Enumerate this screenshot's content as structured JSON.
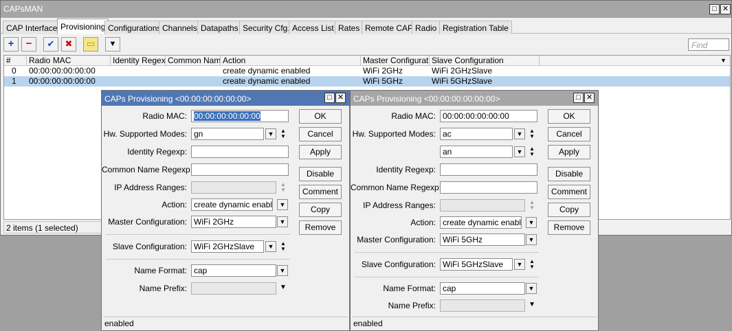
{
  "app": {
    "title": "CAPsMAN",
    "minimize": "□",
    "close": "✕"
  },
  "tabs": [
    "CAP Interface",
    "Provisioning",
    "Configurations",
    "Channels",
    "Datapaths",
    "Security Cfg.",
    "Access List",
    "Rates",
    "Remote CAP",
    "Radio",
    "Registration Table"
  ],
  "active_tab": "Provisioning",
  "toolbar": {
    "add": "+",
    "remove": "−",
    "enable": "✔",
    "disable": "✖",
    "comment": "▭",
    "filter": "▼",
    "find_placeholder": "Find"
  },
  "table": {
    "columns": [
      "#",
      "Radio MAC",
      "Identity Regexp",
      "Common Nam...",
      "Action",
      "Master Configurati...",
      "Slave Configuration"
    ],
    "rows": [
      {
        "num": "0",
        "mac": "00:00:00:00:00:00",
        "identity": "",
        "common": "",
        "action": "create dynamic enabled",
        "master": "WiFi 2GHz",
        "slave": "WiFi 2GHzSlave"
      },
      {
        "num": "1",
        "mac": "00:00:00:00:00:00",
        "identity": "",
        "common": "",
        "action": "create dynamic enabled",
        "master": "WiFi 5GHz",
        "slave": "WiFi 5GHzSlave"
      }
    ],
    "status": "2 items (1 selected)"
  },
  "dialog_left": {
    "title": "CAPs Provisioning <00:00:00:00:00:00>",
    "labels": {
      "radio_mac": "Radio MAC:",
      "hw_modes": "Hw. Supported Modes:",
      "identity": "Identity Regexp:",
      "common": "Common Name Regexp:",
      "ip_ranges": "IP Address Ranges:",
      "action": "Action:",
      "master": "Master Configuration:",
      "slave": "Slave Configuration:",
      "name_format": "Name Format:",
      "name_prefix": "Name Prefix:"
    },
    "values": {
      "radio_mac": "00:00:00:00:00:00",
      "hw_mode_1": "gn",
      "identity": "",
      "common": "",
      "ip_ranges": "",
      "action": "create dynamic enabled",
      "master": "WiFi 2GHz",
      "slave": "WiFi 2GHzSlave",
      "name_format": "cap",
      "name_prefix": ""
    },
    "buttons": [
      "OK",
      "Cancel",
      "Apply",
      "Disable",
      "Comment",
      "Copy",
      "Remove"
    ],
    "status": "enabled"
  },
  "dialog_right": {
    "title": "CAPs Provisioning <00:00:00:00:00:00>",
    "labels": {
      "radio_mac": "Radio MAC:",
      "hw_modes": "Hw. Supported Modes:",
      "identity": "Identity Regexp:",
      "common": "Common Name Regexp:",
      "ip_ranges": "IP Address Ranges:",
      "action": "Action:",
      "master": "Master Configuration:",
      "slave": "Slave Configuration:",
      "name_format": "Name Format:",
      "name_prefix": "Name Prefix:"
    },
    "values": {
      "radio_mac": "00:00:00:00:00:00",
      "hw_mode_1": "ac",
      "hw_mode_2": "an",
      "identity": "",
      "common": "",
      "ip_ranges": "",
      "action": "create dynamic enabled",
      "master": "WiFi 5GHz",
      "slave": "WiFi 5GHzSlave",
      "name_format": "cap",
      "name_prefix": ""
    },
    "buttons": [
      "OK",
      "Cancel",
      "Apply",
      "Disable",
      "Comment",
      "Copy",
      "Remove"
    ],
    "status": "enabled"
  },
  "colors": {
    "active_title": "#5177b3",
    "inactive_title": "#a6a6a6",
    "selection": "#b8d3ee"
  }
}
